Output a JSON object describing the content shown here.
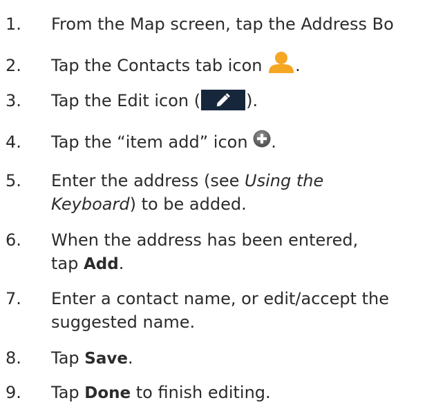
{
  "steps": [
    {
      "num": "1.",
      "text": "From the Map screen, tap the Address Bo"
    },
    {
      "num": "2.",
      "before": "Tap the Contacts tab icon ",
      "after": ".",
      "icon": "person-icon",
      "icon_color": "#f5a623"
    },
    {
      "num": "3.",
      "before": "Tap the Edit icon (",
      "after": ").",
      "icon": "pencil-edit-icon",
      "icon_bg": "#16273c"
    },
    {
      "num": "4.",
      "before": "Tap the “item add” icon ",
      "after": ".",
      "icon": "plus-circle-icon"
    },
    {
      "num": "5.",
      "l1_a": "Enter the address (see ",
      "l1_em": "Using the",
      "l2_em": "Keyboard",
      "l2_b": ") to be added."
    },
    {
      "num": "6.",
      "l1": "When the address has been entered,",
      "l2_a": "tap ",
      "l2_bold": "Add",
      "l2_c": "."
    },
    {
      "num": "7.",
      "l1": "Enter a contact name, or edit/accept the",
      "l2": "suggested name."
    },
    {
      "num": "8.",
      "a": "Tap ",
      "bold": "Save",
      "c": "."
    },
    {
      "num": "9.",
      "a": "Tap ",
      "bold": "Done",
      "c": " to finish editing."
    }
  ]
}
